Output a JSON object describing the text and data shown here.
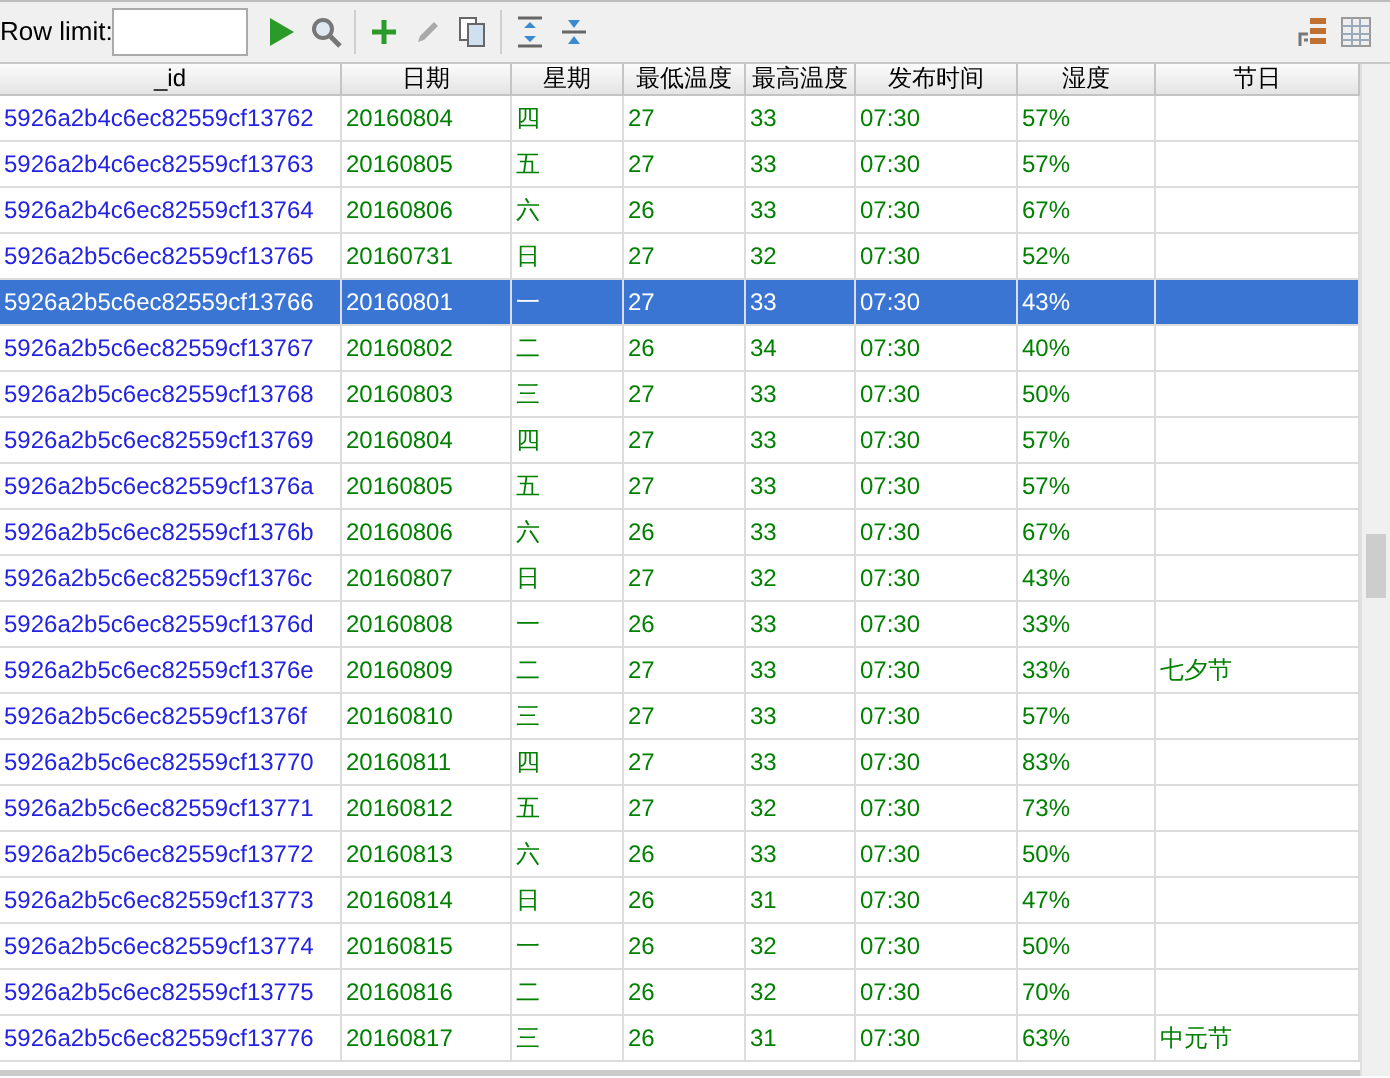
{
  "toolbar": {
    "row_limit": {
      "label": "Row limit:"
    },
    "edit_disabled": true
  },
  "table": {
    "columns": [
      "_id",
      "日期",
      "星期",
      "最低温度",
      "最高温度",
      "发布时间",
      "湿度",
      "节日"
    ],
    "rows": [
      {
        "selected": false,
        "cells": [
          "5926a2b4c6ec82559cf13762",
          "20160804",
          "四",
          "27",
          "33",
          "07:30",
          "57%",
          ""
        ]
      },
      {
        "selected": false,
        "cells": [
          "5926a2b4c6ec82559cf13763",
          "20160805",
          "五",
          "27",
          "33",
          "07:30",
          "57%",
          ""
        ]
      },
      {
        "selected": false,
        "cells": [
          "5926a2b4c6ec82559cf13764",
          "20160806",
          "六",
          "26",
          "33",
          "07:30",
          "67%",
          ""
        ]
      },
      {
        "selected": false,
        "cells": [
          "5926a2b5c6ec82559cf13765",
          "20160731",
          "日",
          "27",
          "32",
          "07:30",
          "52%",
          ""
        ]
      },
      {
        "selected": true,
        "cells": [
          "5926a2b5c6ec82559cf13766",
          "20160801",
          "一",
          "27",
          "33",
          "07:30",
          "43%",
          ""
        ]
      },
      {
        "selected": false,
        "cells": [
          "5926a2b5c6ec82559cf13767",
          "20160802",
          "二",
          "26",
          "34",
          "07:30",
          "40%",
          ""
        ]
      },
      {
        "selected": false,
        "cells": [
          "5926a2b5c6ec82559cf13768",
          "20160803",
          "三",
          "27",
          "33",
          "07:30",
          "50%",
          ""
        ]
      },
      {
        "selected": false,
        "cells": [
          "5926a2b5c6ec82559cf13769",
          "20160804",
          "四",
          "27",
          "33",
          "07:30",
          "57%",
          ""
        ]
      },
      {
        "selected": false,
        "cells": [
          "5926a2b5c6ec82559cf1376a",
          "20160805",
          "五",
          "27",
          "33",
          "07:30",
          "57%",
          ""
        ]
      },
      {
        "selected": false,
        "cells": [
          "5926a2b5c6ec82559cf1376b",
          "20160806",
          "六",
          "26",
          "33",
          "07:30",
          "67%",
          ""
        ]
      },
      {
        "selected": false,
        "cells": [
          "5926a2b5c6ec82559cf1376c",
          "20160807",
          "日",
          "27",
          "32",
          "07:30",
          "43%",
          ""
        ]
      },
      {
        "selected": false,
        "cells": [
          "5926a2b5c6ec82559cf1376d",
          "20160808",
          "一",
          "26",
          "33",
          "07:30",
          "33%",
          ""
        ]
      },
      {
        "selected": false,
        "cells": [
          "5926a2b5c6ec82559cf1376e",
          "20160809",
          "二",
          "27",
          "33",
          "07:30",
          "33%",
          "七夕节"
        ]
      },
      {
        "selected": false,
        "cells": [
          "5926a2b5c6ec82559cf1376f",
          "20160810",
          "三",
          "27",
          "33",
          "07:30",
          "57%",
          ""
        ]
      },
      {
        "selected": false,
        "cells": [
          "5926a2b5c6ec82559cf13770",
          "20160811",
          "四",
          "27",
          "33",
          "07:30",
          "83%",
          ""
        ]
      },
      {
        "selected": false,
        "cells": [
          "5926a2b5c6ec82559cf13771",
          "20160812",
          "五",
          "27",
          "32",
          "07:30",
          "73%",
          ""
        ]
      },
      {
        "selected": false,
        "cells": [
          "5926a2b5c6ec82559cf13772",
          "20160813",
          "六",
          "26",
          "33",
          "07:30",
          "50%",
          ""
        ]
      },
      {
        "selected": false,
        "cells": [
          "5926a2b5c6ec82559cf13773",
          "20160814",
          "日",
          "26",
          "31",
          "07:30",
          "47%",
          ""
        ]
      },
      {
        "selected": false,
        "cells": [
          "5926a2b5c6ec82559cf13774",
          "20160815",
          "一",
          "26",
          "32",
          "07:30",
          "50%",
          ""
        ]
      },
      {
        "selected": false,
        "cells": [
          "5926a2b5c6ec82559cf13775",
          "20160816",
          "二",
          "26",
          "32",
          "07:30",
          "70%",
          ""
        ]
      },
      {
        "selected": false,
        "cells": [
          "5926a2b5c6ec82559cf13776",
          "20160817",
          "三",
          "26",
          "31",
          "07:30",
          "63%",
          "中元节"
        ]
      }
    ]
  }
}
